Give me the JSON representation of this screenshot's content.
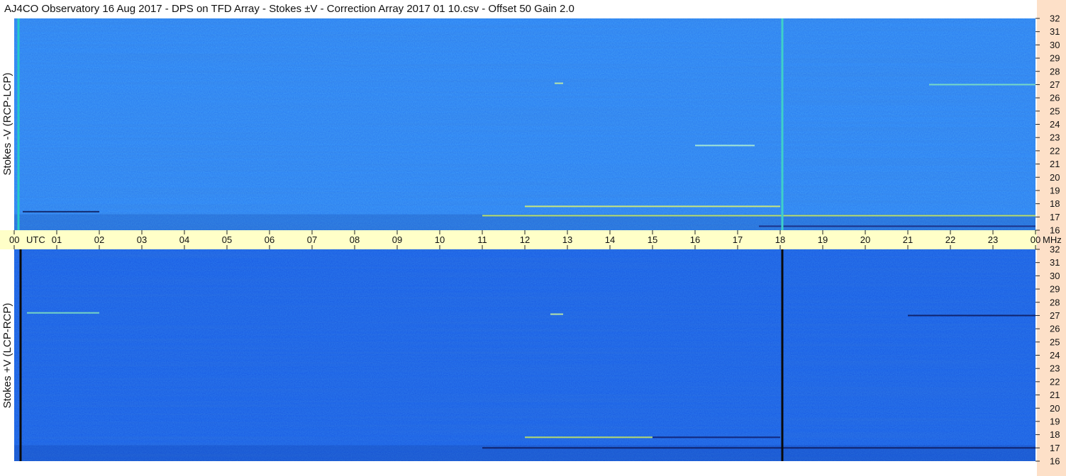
{
  "title": "AJ4CO Observatory  16 Aug 2017  -  DPS on TFD Array  -  Stokes ±V  -  Correction Array 2017 01 10.csv  -  Offset 50  Gain 2.0",
  "chart_data": [
    {
      "type": "heatmap",
      "ylabel": "Stokes -V  (RCP-LCP)",
      "y_ticks": [
        "32",
        "31",
        "30",
        "29",
        "28",
        "27",
        "26",
        "25",
        "24",
        "23",
        "22",
        "21",
        "20",
        "19",
        "18",
        "17",
        "16"
      ],
      "ylim": [
        16,
        32
      ],
      "y_unit": "MHz",
      "x_unit": "UTC",
      "xlim": [
        "00",
        "00"
      ],
      "base_color": "#2d80f2",
      "vertical_lines": [
        {
          "x": 0.1,
          "color": "#25c8c8"
        },
        {
          "x": 18.05,
          "color": "#3fd0c8"
        }
      ],
      "bright_lines": [
        {
          "x": [
            12.0,
            18.0
          ],
          "mhz": 17.8,
          "color": "#d8f070"
        },
        {
          "x": [
            11.0,
            24.0
          ],
          "mhz": 17.1,
          "color": "#c8e860"
        },
        {
          "x": [
            17.5,
            24.0
          ],
          "mhz": 16.3,
          "color": "#1a2a80"
        },
        {
          "x": [
            0.2,
            2.0
          ],
          "mhz": 17.4,
          "color": "#102060"
        },
        {
          "x": [
            12.7,
            12.9
          ],
          "mhz": 27.1,
          "color": "#c8f0a0"
        },
        {
          "x": [
            16.0,
            17.4
          ],
          "mhz": 22.4,
          "color": "#b0f0d0"
        },
        {
          "x": [
            21.5,
            24.0
          ],
          "mhz": 27.0,
          "color": "#80e0c0"
        }
      ]
    },
    {
      "type": "heatmap",
      "ylabel": "Stokes +V  (LCP-RCP)",
      "y_ticks": [
        "32",
        "31",
        "30",
        "29",
        "28",
        "27",
        "26",
        "25",
        "24",
        "23",
        "22",
        "21",
        "20",
        "19",
        "18",
        "17",
        "16"
      ],
      "ylim": [
        16,
        32
      ],
      "y_unit": "MHz",
      "x_unit": "UTC",
      "xlim": [
        "00",
        "00"
      ],
      "base_color": "#1c5fe4",
      "vertical_lines": [
        {
          "x": 0.15,
          "color": "#0a0a0a"
        },
        {
          "x": 18.05,
          "color": "#0a0a0a"
        }
      ],
      "bright_lines": [
        {
          "x": [
            12.0,
            15.0
          ],
          "mhz": 17.8,
          "color": "#c8e860"
        },
        {
          "x": [
            15.0,
            18.0
          ],
          "mhz": 17.8,
          "color": "#102070"
        },
        {
          "x": [
            11.0,
            24.0
          ],
          "mhz": 17.0,
          "color": "#0e1c60"
        },
        {
          "x": [
            12.6,
            12.9
          ],
          "mhz": 27.1,
          "color": "#c8f0a0"
        },
        {
          "x": [
            0.3,
            2.0
          ],
          "mhz": 27.2,
          "color": "#80e0c0"
        },
        {
          "x": [
            21.0,
            24.0
          ],
          "mhz": 27.0,
          "color": "#0e1c60"
        }
      ]
    }
  ],
  "time_axis": {
    "labels": [
      "00",
      "01",
      "02",
      "03",
      "04",
      "05",
      "06",
      "07",
      "08",
      "09",
      "10",
      "11",
      "12",
      "13",
      "14",
      "15",
      "16",
      "17",
      "18",
      "19",
      "20",
      "21",
      "22",
      "23",
      "00"
    ],
    "utc_label": "UTC",
    "mhz_label": "MHz"
  },
  "colors": {
    "axis_band": "#ffffc8",
    "right_panel": "#fde0c8",
    "top_base": "#2d80f2",
    "bottom_base": "#1c5fe4"
  }
}
